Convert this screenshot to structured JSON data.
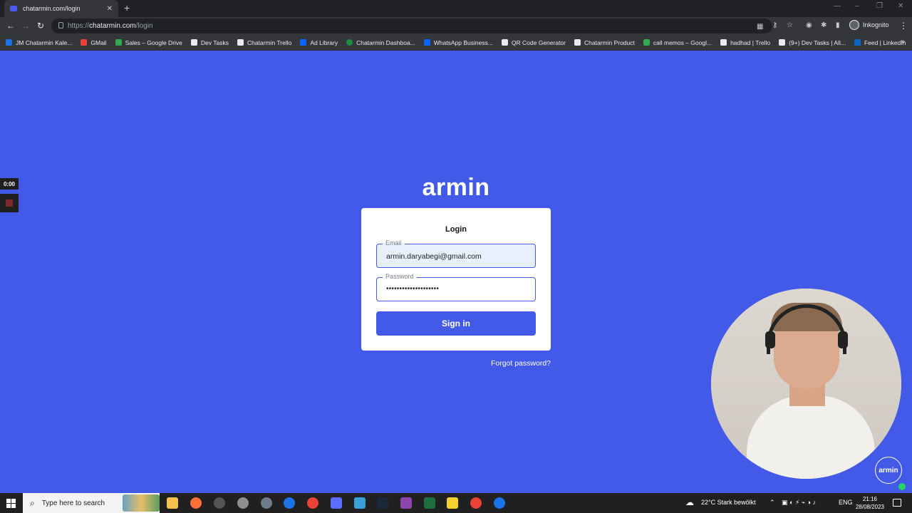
{
  "browser": {
    "tab_title": "chatarmin.com/login",
    "tab_close": "✕",
    "new_tab": "+",
    "url_prefix": "https://",
    "url_host": "chatarmin.com",
    "url_path": "/login",
    "profile_label": "Inkognito",
    "bookmarks": [
      "JM Chatarmin Kale...",
      "GMail",
      "Sales – Google Drive",
      "Dev Tasks",
      "Chatarmin Trello",
      "Ad Library",
      "Chatarmin Dashboa...",
      "WhatsApp Business...",
      "QR Code Generator",
      "Chatarmin Product",
      "call memos – Googl...",
      "hadhad | Trello",
      "(9+) Dev Tasks | All...",
      "Feed | LinkedIn"
    ],
    "bookmarks_more": "»"
  },
  "recording": {
    "timer": "0:00"
  },
  "login": {
    "logo": "armin",
    "title": "Login",
    "email_label": "Email",
    "email_value": "armin.daryabegi@gmail.com",
    "password_label": "Password",
    "password_value": "••••••••••••••••••••",
    "submit_label": "Sign in",
    "forgot_label": "Forgot password?"
  },
  "webcam": {
    "badge": "armin"
  },
  "taskbar": {
    "search_placeholder": "Type here to search",
    "weather": "22°C  Stark bewölkt",
    "language": "ENG",
    "time": "21:16",
    "date": "28/08/2023"
  },
  "colors": {
    "page_bg": "#4359e8",
    "primary": "#4359e8",
    "card_bg": "#ffffff"
  }
}
